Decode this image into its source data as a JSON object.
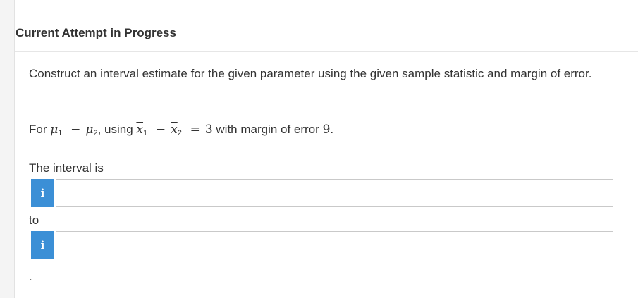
{
  "header": {
    "title": "Current Attempt in Progress"
  },
  "question": {
    "text": "Construct an interval estimate for the given parameter using the given sample statistic and margin of error.",
    "formula": {
      "prefix": "For",
      "mu": "μ",
      "sub1": "1",
      "minus": "−",
      "sub2": "2",
      "using": ", using",
      "x": "x",
      "equals": "=",
      "value": "3",
      "margin_text": "with margin of error",
      "margin_value": "9",
      "end": "."
    }
  },
  "interval": {
    "label": "The interval is",
    "to_label": "to",
    "info_icon": "i",
    "lower_value": "",
    "upper_value": "",
    "trailing": "."
  }
}
